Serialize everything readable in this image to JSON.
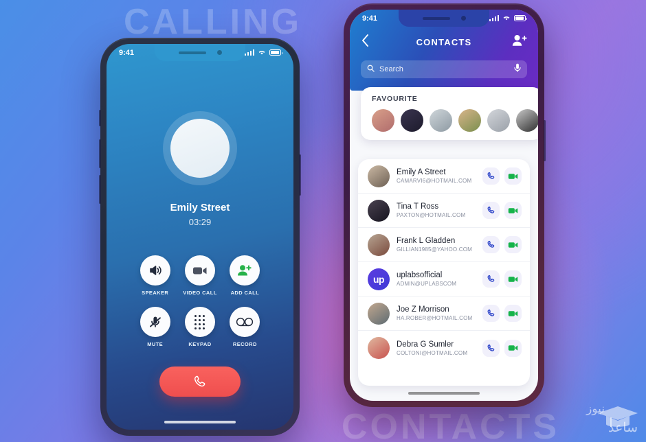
{
  "background": {
    "watermark_left": "CALLING",
    "watermark_right": "CONTACTS",
    "logo_line1": "نیوز",
    "logo_line2": "ساعد"
  },
  "colors": {
    "accent_blue": "#2b4fb8",
    "accent_purple": "#6a2bc4",
    "end_call_red": "#ef4e4e",
    "video_green": "#15b34a",
    "call_blue": "#2f46c9"
  },
  "left_phone": {
    "status_bar": {
      "time": "9:41"
    },
    "caller_name": "Emily Street",
    "call_duration": "03:29",
    "controls": [
      {
        "label": "SPEAKER",
        "icon": "speaker-icon"
      },
      {
        "label": "VIDEO CALL",
        "icon": "video-camera-icon"
      },
      {
        "label": "ADD CALL",
        "icon": "add-person-icon"
      },
      {
        "label": "MUTE",
        "icon": "mute-microphone-icon"
      },
      {
        "label": "KEYPAD",
        "icon": "keypad-dots-icon"
      },
      {
        "label": "RECORD",
        "icon": "record-reels-icon"
      }
    ],
    "end_call": {
      "icon": "phone-hangup-icon"
    }
  },
  "right_phone": {
    "status_bar": {
      "time": "9:41"
    },
    "header": {
      "title": "CONTACTS",
      "back_icon": "chevron-left-icon",
      "add_icon": "add-person-icon"
    },
    "search": {
      "placeholder": "Search",
      "value": "",
      "search_icon": "search-icon",
      "mic_icon": "microphone-icon"
    },
    "favourite": {
      "title": "FAVOURITE",
      "avatars": [
        {
          "name": "favourite-avatar-1",
          "color1": "#d9a08a",
          "color2": "#b06c6c"
        },
        {
          "name": "favourite-avatar-2",
          "color1": "#3a3550",
          "color2": "#1d1b2c"
        },
        {
          "name": "favourite-avatar-3",
          "color1": "#cfd6da",
          "color2": "#8e9aa3"
        },
        {
          "name": "favourite-avatar-4",
          "color1": "#d8b48a",
          "color2": "#7a8f4e"
        },
        {
          "name": "favourite-avatar-5",
          "color1": "#d3d6db",
          "color2": "#9aa0a8"
        },
        {
          "name": "favourite-avatar-6",
          "color1": "#c9c9c9",
          "color2": "#2e2e2e"
        }
      ]
    },
    "contacts": [
      {
        "name": "Emily A Street",
        "email": "CAMARVI6@HOTMAIL.COM",
        "avatar_type": "photo",
        "color1": "#cbb9a4",
        "color2": "#6d6054"
      },
      {
        "name": "Tina T Ross",
        "email": "PAXTON@HOTMAIL.COM",
        "avatar_type": "photo",
        "color1": "#4a4250",
        "color2": "#16141f"
      },
      {
        "name": "Frank L Gladden",
        "email": "GILLIAN1985@YAHOO.COM",
        "avatar_type": "photo",
        "color1": "#b7a593",
        "color2": "#7a4a3c"
      },
      {
        "name": "uplabsofficial",
        "email": "ADMIN@UPLABSCOM",
        "avatar_type": "logo",
        "logo_text": "up"
      },
      {
        "name": "Joe Z Morrison",
        "email": "HA.ROBER@HOTMAIL.COM",
        "avatar_type": "photo",
        "color1": "#c3a88f",
        "color2": "#5d6b72"
      },
      {
        "name": "Debra G Sumler",
        "email": "COLTONI@HOTMAIL.COM",
        "avatar_type": "photo",
        "color1": "#e0b9a0",
        "color2": "#c8524e"
      }
    ],
    "row_actions": {
      "call_icon": "phone-icon",
      "video_icon": "video-camera-icon"
    }
  }
}
